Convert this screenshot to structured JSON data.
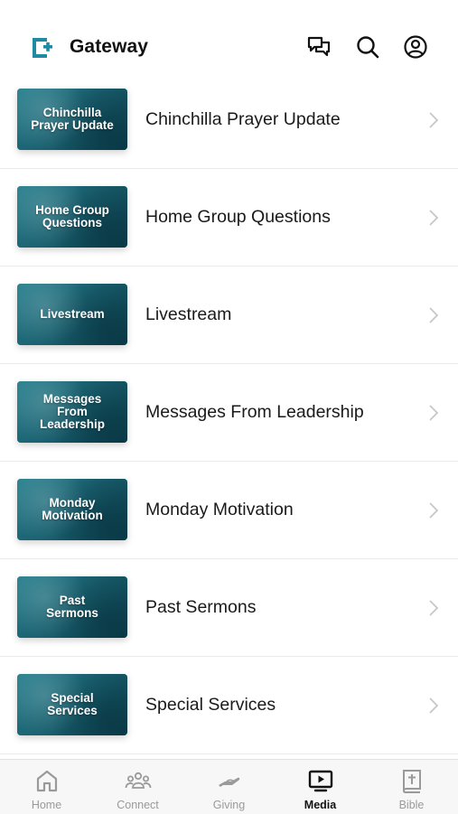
{
  "app": {
    "title": "Gateway"
  },
  "header": {
    "icons": [
      "chat-icon",
      "search-icon",
      "profile-icon"
    ]
  },
  "items": [
    {
      "thumb_label": "Chinchilla\nPrayer Update",
      "title": "Chinchilla Prayer Update"
    },
    {
      "thumb_label": "Home Group\nQuestions",
      "title": "Home Group Questions"
    },
    {
      "thumb_label": "Livestream",
      "title": "Livestream"
    },
    {
      "thumb_label": "Messages\nFrom\nLeadership",
      "title": "Messages From Leadership"
    },
    {
      "thumb_label": "Monday\nMotivation",
      "title": "Monday Motivation"
    },
    {
      "thumb_label": "Past\nSermons",
      "title": "Past Sermons"
    },
    {
      "thumb_label": "Special\nServices",
      "title": "Special Services"
    }
  ],
  "tabs": [
    {
      "label": "Home",
      "icon": "home-icon"
    },
    {
      "label": "Connect",
      "icon": "people-icon"
    },
    {
      "label": "Giving",
      "icon": "giving-hand-icon"
    },
    {
      "label": "Media",
      "icon": "media-play-icon",
      "active": true
    },
    {
      "label": "Bible",
      "icon": "bible-icon"
    }
  ],
  "colors": {
    "accent": "#1f8aa3",
    "thumb": "#1f6b78",
    "inactive": "#9a9a9a"
  }
}
